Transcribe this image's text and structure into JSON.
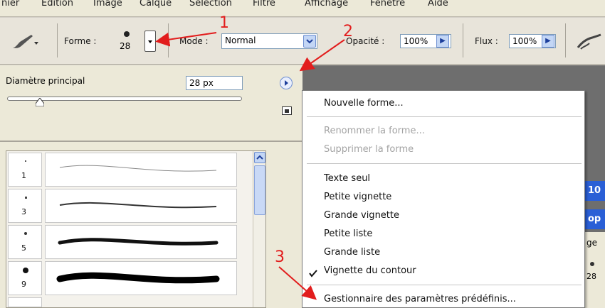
{
  "menubar": {
    "items": [
      "nier",
      "Edition",
      "Image",
      "Calque",
      "Sélection",
      "Filtre",
      "Affichage",
      "Fenêtre",
      "Aide"
    ]
  },
  "toolbar": {
    "shape_label": "Forme :",
    "brush_size": "28",
    "mode_label": "Mode :",
    "mode_value": "Normal",
    "opacity_label": "Opacité :",
    "opacity_value": "100%",
    "flow_label": "Flux :",
    "flow_value": "100%"
  },
  "brush_panel": {
    "diameter_label": "Diamètre principal",
    "diameter_value": "28 px",
    "slider_fraction": 0.14,
    "brushes": [
      {
        "size": "1"
      },
      {
        "size": "3"
      },
      {
        "size": "5"
      },
      {
        "size": "9"
      }
    ]
  },
  "flyout": {
    "items": [
      {
        "label": "Nouvelle forme...",
        "enabled": true
      },
      {
        "label": "Renommer la forme...",
        "enabled": false
      },
      {
        "label": "Supprimer la forme",
        "enabled": false
      },
      {
        "label": "Texte seul",
        "enabled": true
      },
      {
        "label": "Petite vignette",
        "enabled": true
      },
      {
        "label": "Grande vignette",
        "enabled": true
      },
      {
        "label": "Petite liste",
        "enabled": true
      },
      {
        "label": "Grande liste",
        "enabled": true
      },
      {
        "label": "Vignette du contour",
        "enabled": true,
        "checked": true
      },
      {
        "label": "Gestionnaire des paramètres prédéfinis...",
        "enabled": true
      }
    ]
  },
  "background_panel": {
    "strip1": "10",
    "strip2": "op",
    "strip3": "ge",
    "strip4": "28"
  },
  "annotations": {
    "one": "1",
    "two": "2",
    "three": "3"
  },
  "colors": {
    "annotation": "#e21d1d",
    "accent": "#2a5fd6"
  }
}
